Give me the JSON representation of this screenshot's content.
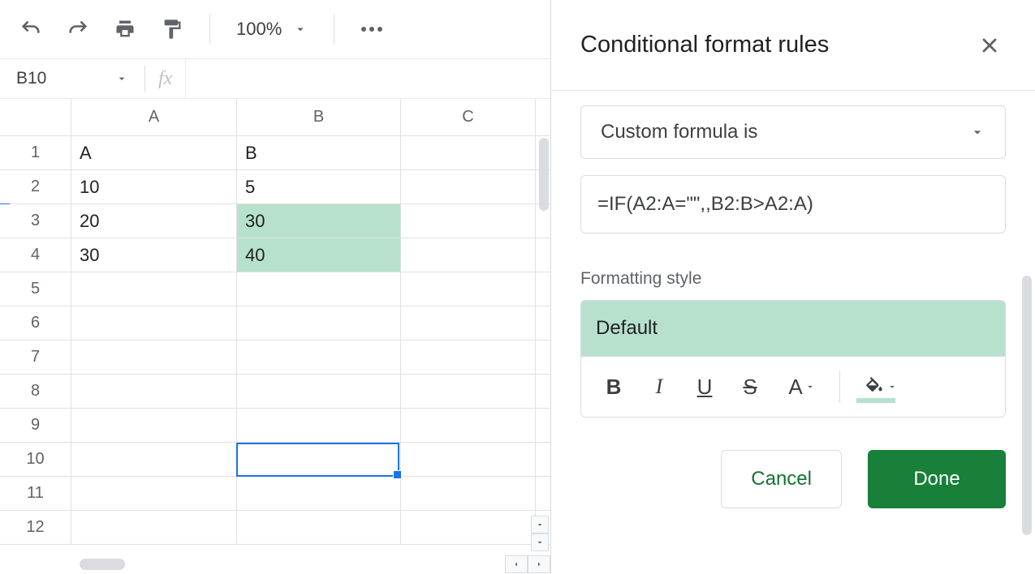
{
  "toolbar": {
    "zoom": "100%"
  },
  "nameBox": "B10",
  "formulaBar": "",
  "columns": [
    "A",
    "B",
    "C"
  ],
  "rows": [
    {
      "n": "1",
      "A": "A",
      "B": "B",
      "C": "",
      "hlB": false
    },
    {
      "n": "2",
      "A": "10",
      "B": "5",
      "C": "",
      "hlB": false
    },
    {
      "n": "3",
      "A": "20",
      "B": "30",
      "C": "",
      "hlB": true
    },
    {
      "n": "4",
      "A": "30",
      "B": "40",
      "C": "",
      "hlB": true
    },
    {
      "n": "5",
      "A": "",
      "B": "",
      "C": "",
      "hlB": false
    },
    {
      "n": "6",
      "A": "",
      "B": "",
      "C": "",
      "hlB": false
    },
    {
      "n": "7",
      "A": "",
      "B": "",
      "C": "",
      "hlB": false
    },
    {
      "n": "8",
      "A": "",
      "B": "",
      "C": "",
      "hlB": false
    },
    {
      "n": "9",
      "A": "",
      "B": "",
      "C": "",
      "hlB": false
    },
    {
      "n": "10",
      "A": "",
      "B": "",
      "C": "",
      "hlB": false
    },
    {
      "n": "11",
      "A": "",
      "B": "",
      "C": "",
      "hlB": false
    },
    {
      "n": "12",
      "A": "",
      "B": "",
      "C": "",
      "hlB": false
    }
  ],
  "selectedCell": "B10",
  "panel": {
    "title": "Conditional format rules",
    "ruleType": "Custom formula is",
    "formula": "=IF(A2:A=\"\",,B2:B>A2:A)",
    "sectionLabel": "Formatting style",
    "stylePreview": "Default",
    "fillUnderlineColor": "#b7e1cd",
    "cancel": "Cancel",
    "done": "Done"
  }
}
